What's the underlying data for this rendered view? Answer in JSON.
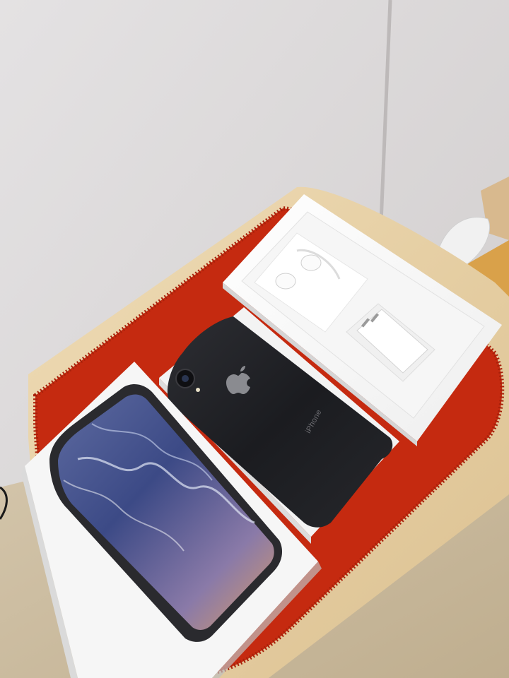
{
  "scene": {
    "description_free": true,
    "phone_back_text": "iPhone",
    "colors": {
      "wall": "#dcd9d9",
      "floor": "#cfc1a9",
      "stool_wood": "#e8d3a8",
      "mat_red": "#c8280f",
      "box_white": "#f7f7f7",
      "phone_black": "#1e1e22"
    },
    "icons": [
      "apple-logo-icon"
    ]
  }
}
